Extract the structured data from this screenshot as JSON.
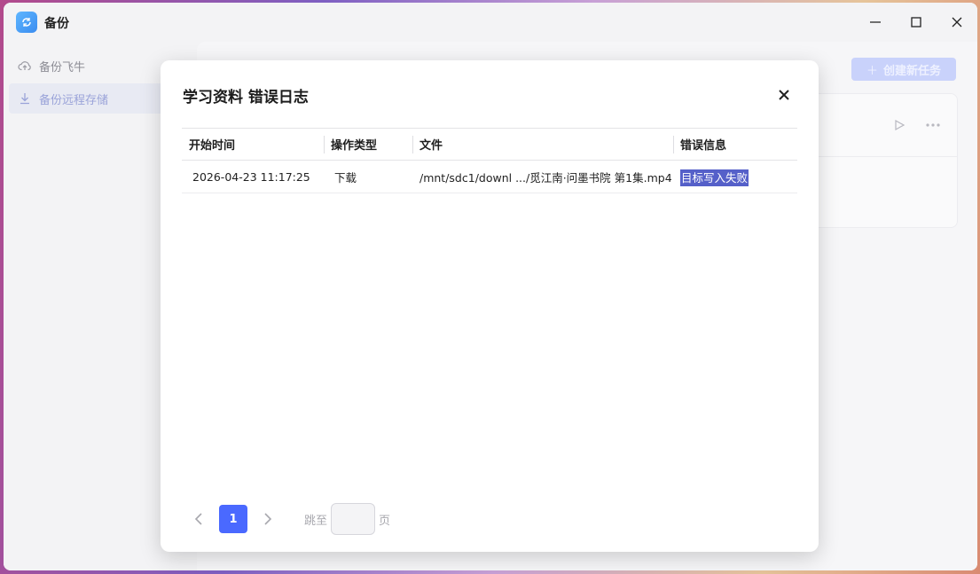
{
  "window": {
    "title": "备份"
  },
  "sidebar": {
    "items": [
      {
        "label": "备份飞牛",
        "icon": "cloud-upload-icon"
      },
      {
        "label": "备份远程存储",
        "icon": "download-icon"
      }
    ]
  },
  "main": {
    "create_button": "创建新任务"
  },
  "modal": {
    "title": "学习资料 错误日志",
    "columns": [
      "开始时间",
      "操作类型",
      "文件",
      "错误信息"
    ],
    "rows": [
      {
        "start_time": "2026-04-23 11:17:25",
        "op_type": "下载",
        "file": "/mnt/sdc1/downl .../觅江南·问墨书院 第1集.mp4",
        "error": "目标写入失败"
      }
    ],
    "pagination": {
      "current_page": "1",
      "jump_label": "跳至",
      "page_suffix": "页"
    }
  },
  "colors": {
    "accent": "#4a69ff",
    "error_highlight": "#5560c9"
  }
}
